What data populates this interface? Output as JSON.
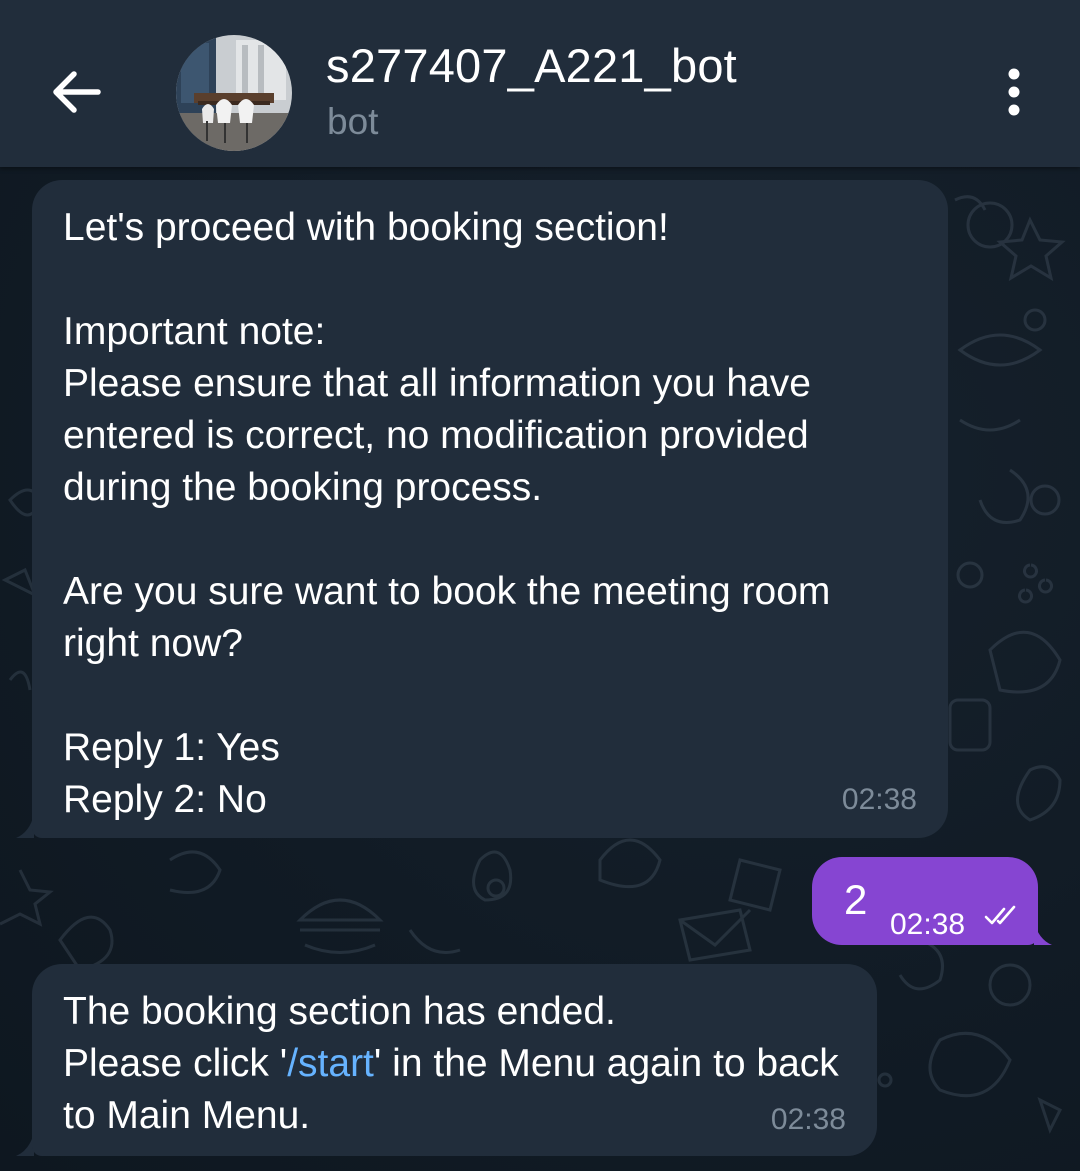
{
  "header": {
    "back_icon": "arrow-left-icon",
    "title": "s277407_A221_bot",
    "subtitle": "bot",
    "menu_icon": "more-vertical-icon"
  },
  "messages": [
    {
      "direction": "incoming",
      "text": "Let's proceed with booking section!\n\nImportant note:\nPlease ensure that all information you have entered is correct, no modification provided during the booking process.\n\nAre you sure want to book the meeting room right now?\n\nReply 1: Yes\nReply 2: No",
      "time": "02:38"
    },
    {
      "direction": "outgoing",
      "text": "2",
      "time": "02:38",
      "status_icon": "double-check-icon"
    },
    {
      "direction": "incoming",
      "text_before": "The booking section has ended.\nPlease click '",
      "link": "/start",
      "text_after": "' in the Menu again to back to Main Menu.",
      "time": "02:38"
    }
  ],
  "colors": {
    "header_bg": "#212d3b",
    "incoming_bubble": "#212d3b",
    "outgoing_bubble": "#8645d2",
    "link": "#66b3ff",
    "muted_text": "#7d8b99"
  }
}
